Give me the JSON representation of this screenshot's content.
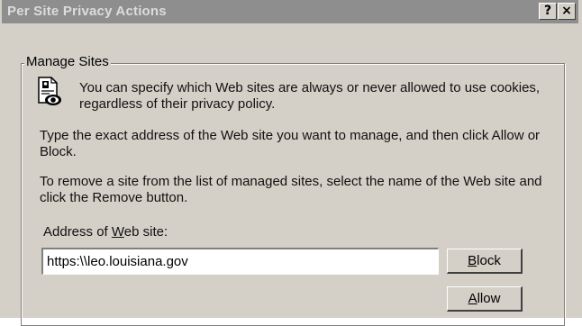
{
  "window": {
    "title": "Per Site Privacy Actions",
    "help_label": "?",
    "close_label": "×"
  },
  "group": {
    "label": "Manage Sites",
    "icon": "privacy-info-icon"
  },
  "texts": {
    "intro": "You can specify which Web sites are always or never allowed to use cookies, regardless of their privacy policy.",
    "type_instructions": "Type the exact address of the Web site you want to manage, and then click Allow or Block.",
    "remove_instructions": "To remove a site from the list of managed sites, select the name of the Web site and click the Remove button.",
    "address_label_pre": "Address of ",
    "address_label_ul": "W",
    "address_label_post": "eb site:"
  },
  "address": {
    "value": "https:\\\\leo.louisiana.gov",
    "placeholder": ""
  },
  "buttons": {
    "block_ul": "B",
    "block_rest": "lock",
    "allow_ul": "A",
    "allow_rest": "llow"
  }
}
